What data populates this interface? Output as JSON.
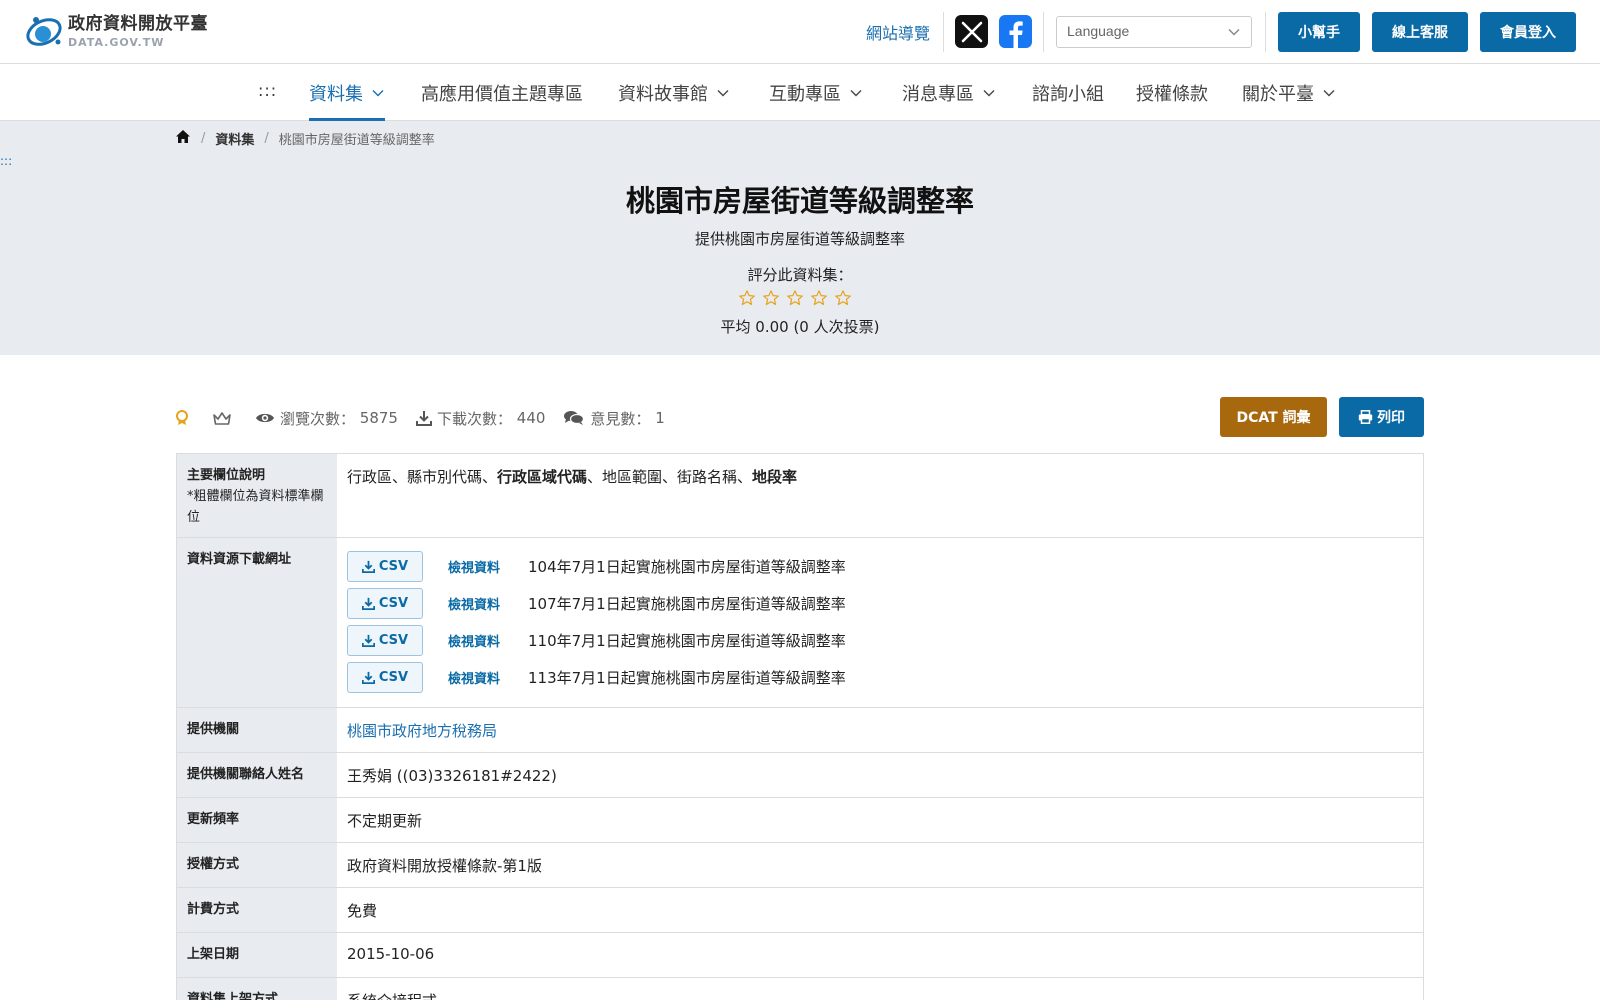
{
  "header": {
    "logo_zh": "政府資料開放平臺",
    "logo_en": "DATA.GOV.TW",
    "sitemap": "網站導覽",
    "language_placeholder": "Language",
    "helper_btn": "小幫手",
    "support_btn": "線上客服",
    "login_btn": "會員登入"
  },
  "nav": {
    "access_key": ":::",
    "items": [
      {
        "label": "資料集",
        "dropdown": true
      },
      {
        "label": "高應用價值主題專區",
        "dropdown": false
      },
      {
        "label": "資料故事館",
        "dropdown": true
      },
      {
        "label": "互動專區",
        "dropdown": true
      },
      {
        "label": "消息專區",
        "dropdown": true
      },
      {
        "label": "諮詢小組",
        "dropdown": false
      },
      {
        "label": "授權條款",
        "dropdown": false
      },
      {
        "label": "關於平臺",
        "dropdown": true
      }
    ]
  },
  "breadcrumb": {
    "level1": "資料集",
    "current": "桃園市房屋街道等級調整率",
    "access_key": ":::"
  },
  "dataset": {
    "title": "桃園市房屋街道等級調整率",
    "description": "提供桃園市房屋街道等級調整率",
    "rate_label": "評分此資料集：",
    "rating_stars": 0,
    "rating_max": 5,
    "rating_avg": "平均 0.00 (0 人次投票)"
  },
  "stats": {
    "views_label": "瀏覽次數：",
    "views": "5875",
    "downloads_label": "下載次數：",
    "downloads": "440",
    "comments_label": "意見數：",
    "comments": "1",
    "dcat_btn": "DCAT 詞彙",
    "print_btn": "列印"
  },
  "table": {
    "fields": {
      "label": "主要欄位說明",
      "sublabel": "*粗體欄位為資料標準欄位",
      "p1": "行政區、縣市別代碼、",
      "b1": "行政區域代碼",
      "p2": "、地區範圍、街路名稱、",
      "b2": "地段率"
    },
    "resources": {
      "label": "資料資源下載網址",
      "csv_label": "CSV",
      "view_label": "檢視資料",
      "items": [
        "104年7月1日起實施桃園市房屋街道等級調整率",
        "107年7月1日起實施桃園市房屋街道等級調整率",
        "110年7月1日起實施桃園市房屋街道等級調整率",
        "113年7月1日起實施桃園市房屋街道等級調整率"
      ]
    },
    "rows": [
      {
        "label": "提供機關",
        "value": "桃園市政府地方稅務局",
        "link": true
      },
      {
        "label": "提供機關聯絡人姓名",
        "value": "王秀娟 ((03)3326181#2422)"
      },
      {
        "label": "更新頻率",
        "value": "不定期更新"
      },
      {
        "label": "授權方式",
        "value": "政府資料開放授權條款-第1版"
      },
      {
        "label": "計費方式",
        "value": "免費"
      },
      {
        "label": "上架日期",
        "value": "2015-10-06"
      },
      {
        "label": "資料集上架方式",
        "value": "系統介接程式"
      }
    ]
  },
  "colors": {
    "primary": "#0a6aa6",
    "dcat": "#a8690e",
    "star": "#e7a21b",
    "hero_bg": "#e8ecf1"
  }
}
